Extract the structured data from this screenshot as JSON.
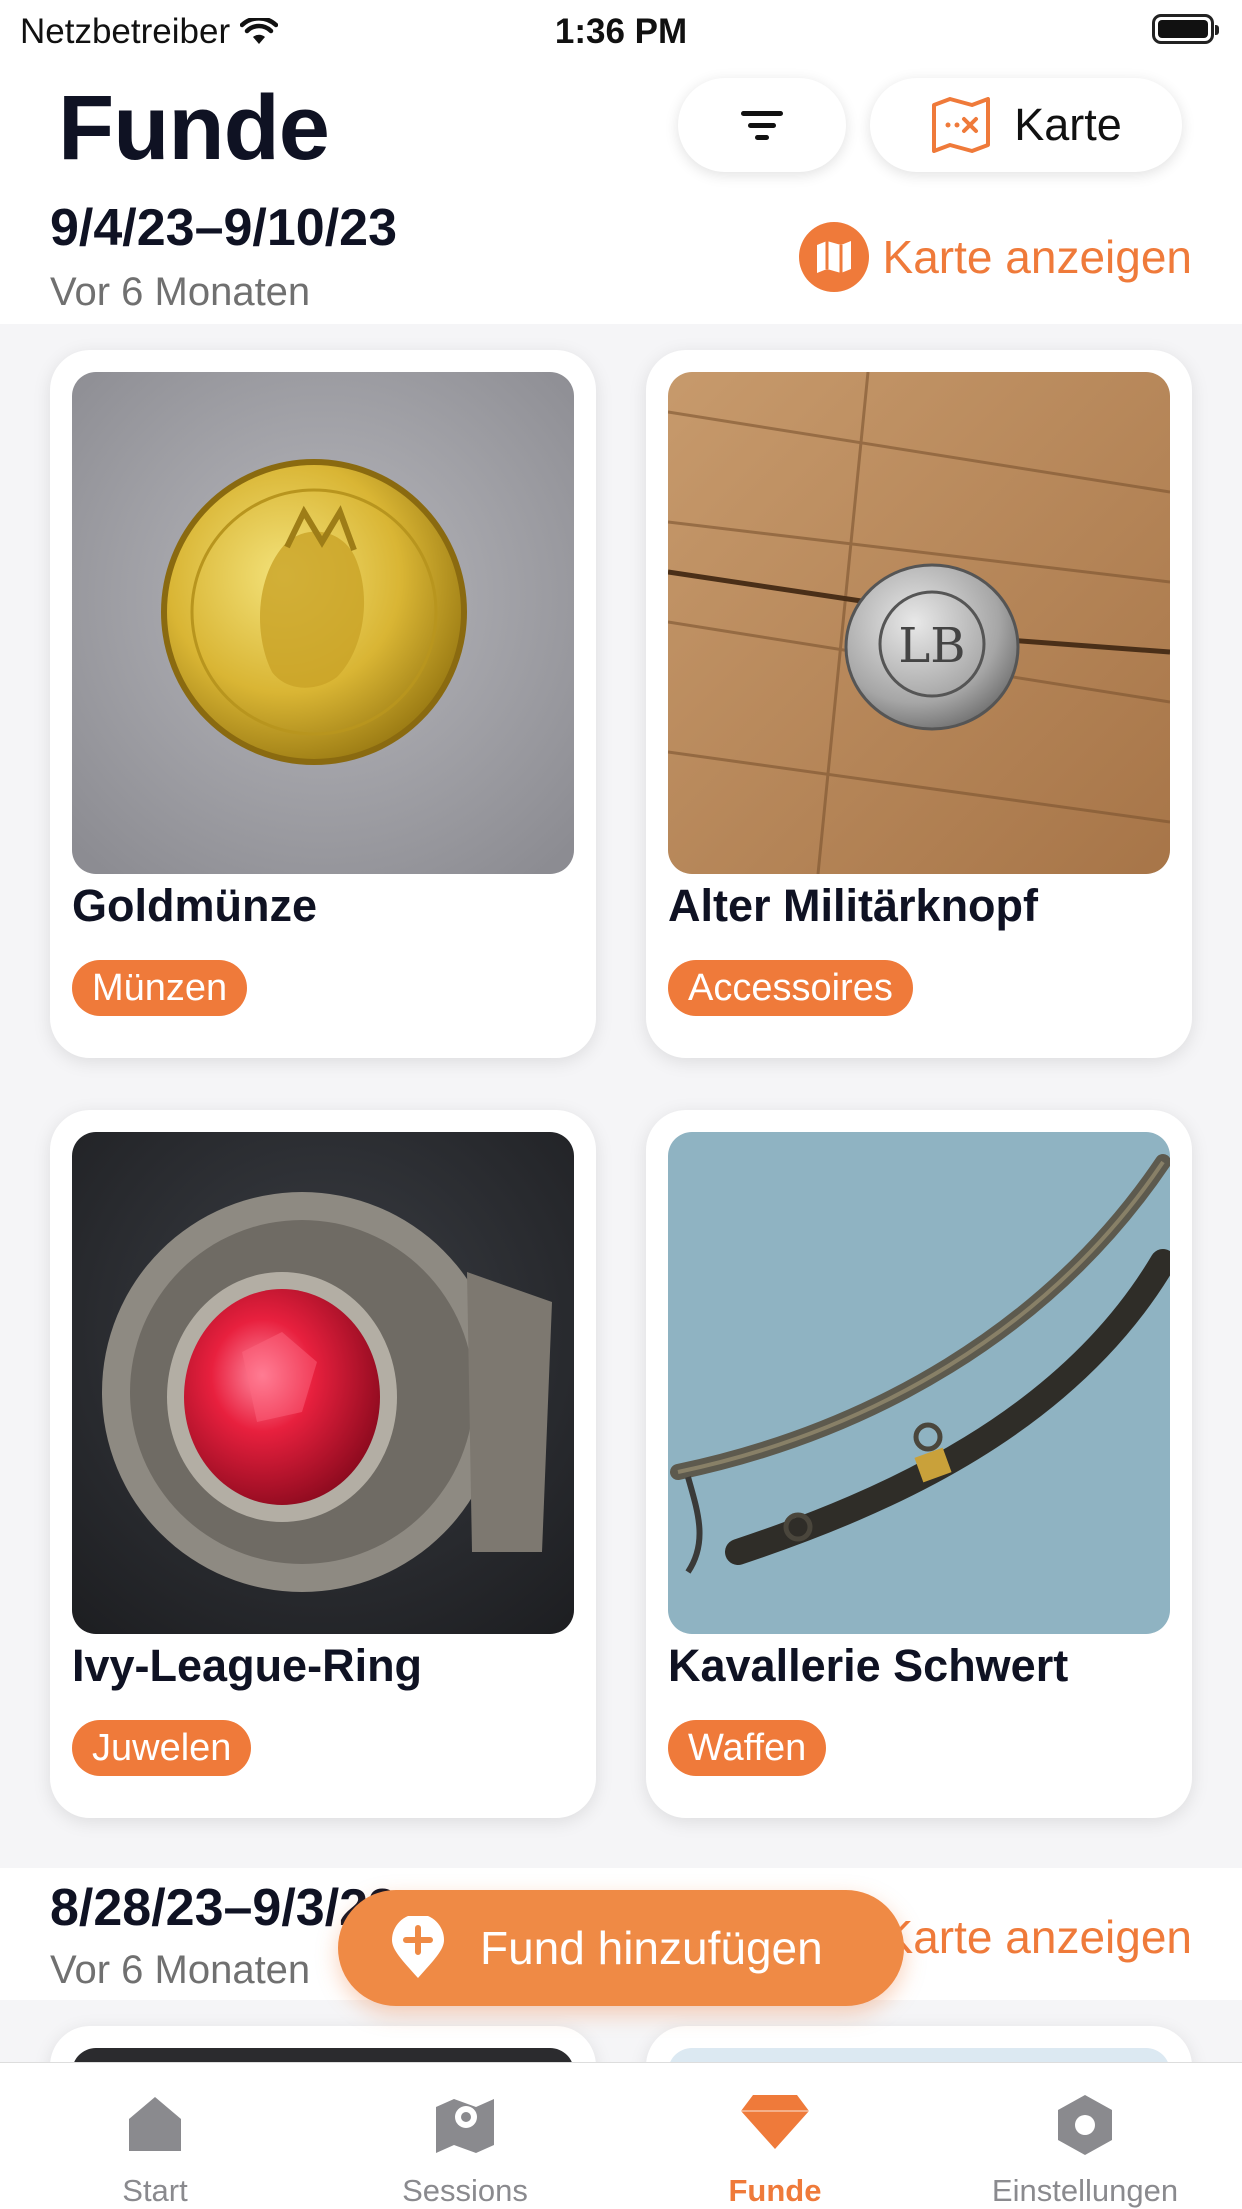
{
  "status_bar": {
    "carrier": "Netzbetreiber",
    "time": "1:36 PM"
  },
  "header": {
    "title": "Funde",
    "filter_icon": "filter-icon",
    "map_button_label": "Karte",
    "map_button_icon": "map-icon"
  },
  "sections": [
    {
      "date_range": "9/4/23–9/10/23",
      "relative": "Vor 6 Monaten",
      "map_link": "Karte anzeigen",
      "finds": [
        {
          "title": "Goldmünze",
          "category": "Münzen"
        },
        {
          "title": "Alter Militärknopf",
          "category": "Accessoires"
        },
        {
          "title": "Ivy-League-Ring",
          "category": "Juwelen"
        },
        {
          "title": "Kavallerie Schwert",
          "category": "Waffen"
        }
      ]
    },
    {
      "date_range": "8/28/23–9/3/23",
      "relative": "Vor 6 Monaten",
      "map_link": "Karte anzeigen"
    }
  ],
  "fab": {
    "label": "Fund hinzufügen",
    "icon": "add-location-icon"
  },
  "tabbar": {
    "items": [
      {
        "label": "Start",
        "icon": "home-icon",
        "active": false
      },
      {
        "label": "Sessions",
        "icon": "map-pin-icon",
        "active": false
      },
      {
        "label": "Funde",
        "icon": "diamond-icon",
        "active": true
      },
      {
        "label": "Einstellungen",
        "icon": "settings-icon",
        "active": false
      }
    ]
  },
  "colors": {
    "accent": "#ef7a3a",
    "background": "#f5f5f7",
    "text": "#0f1223",
    "inactive": "#8a8a8e"
  }
}
